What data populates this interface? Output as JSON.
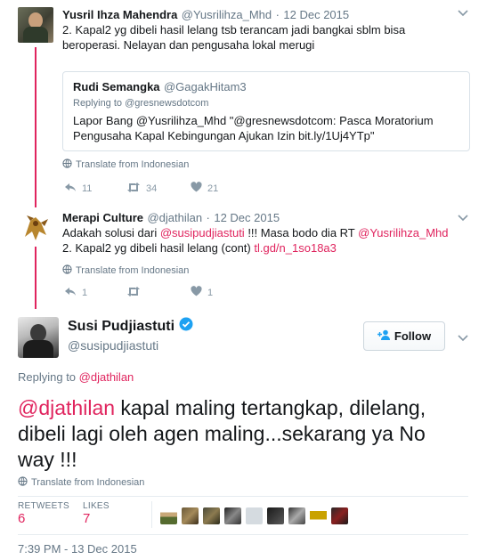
{
  "tweet1": {
    "name": "Yusril Ihza Mahendra",
    "handle": "@Yusrilihza_Mhd",
    "separator": "·",
    "date": "12 Dec 2015",
    "text_line1": "2. Kapal2 yg dibeli hasil lelang tsb terancam jadi bangkai sblm bisa",
    "text_line2": "beroperasi. Nelayan dan pengusaha lokal merugi",
    "quote": {
      "name": "Rudi Semangka",
      "handle": "@GagakHitam3",
      "replying": "Replying to @gresnewsdotcom",
      "line1": "Lapor Bang @Yusrilihza_Mhd \"@gresnewsdotcom: Pasca Moratorium",
      "line2": "Pengusaha Kapal Kebingungan Ajukan Izin bit.ly/1Uj4YTp\""
    },
    "translate": "Translate from Indonesian",
    "replies": "11",
    "retweets": "34",
    "likes": "21"
  },
  "tweet2": {
    "name": "Merapi Culture",
    "handle": "@djathilan",
    "separator": "·",
    "date": "12 Dec 2015",
    "line1_pre": "Adakah solusi dari ",
    "line1_mention1": "@susipudjiastuti",
    "line1_mid": " !!! Masa bodo dia RT ",
    "line1_mention2": "@Yusrilihza_Mhd",
    "line2_pre": "2. Kapal2 yg dibeli hasil lelang (cont) ",
    "line2_link": "tl.gd/n_1so18a3",
    "translate": "Translate from Indonesian",
    "replies": "1",
    "likes": "1"
  },
  "main": {
    "name": "Susi Pudjiastuti",
    "handle": "@susipudjiastuti",
    "follow_label": "Follow",
    "replying_prefix": "Replying to ",
    "replying_handle": "@djathilan",
    "mention": "@djathilan",
    "text_line1": " kapal maling tertangkap, dilelang,",
    "text_line2": "dibeli lagi oleh agen maling...sekarang ya No",
    "text_line3": "way !!!",
    "translate": "Translate from Indonesian",
    "retweets_label": "RETWEETS",
    "retweets_value": "6",
    "likes_label": "LIKES",
    "likes_value": "7",
    "timestamp": "7:39 PM - 13 Dec 2015"
  },
  "colors": {
    "accent": "#e0245e",
    "verified": "#1da1f2",
    "muted": "#657786"
  }
}
